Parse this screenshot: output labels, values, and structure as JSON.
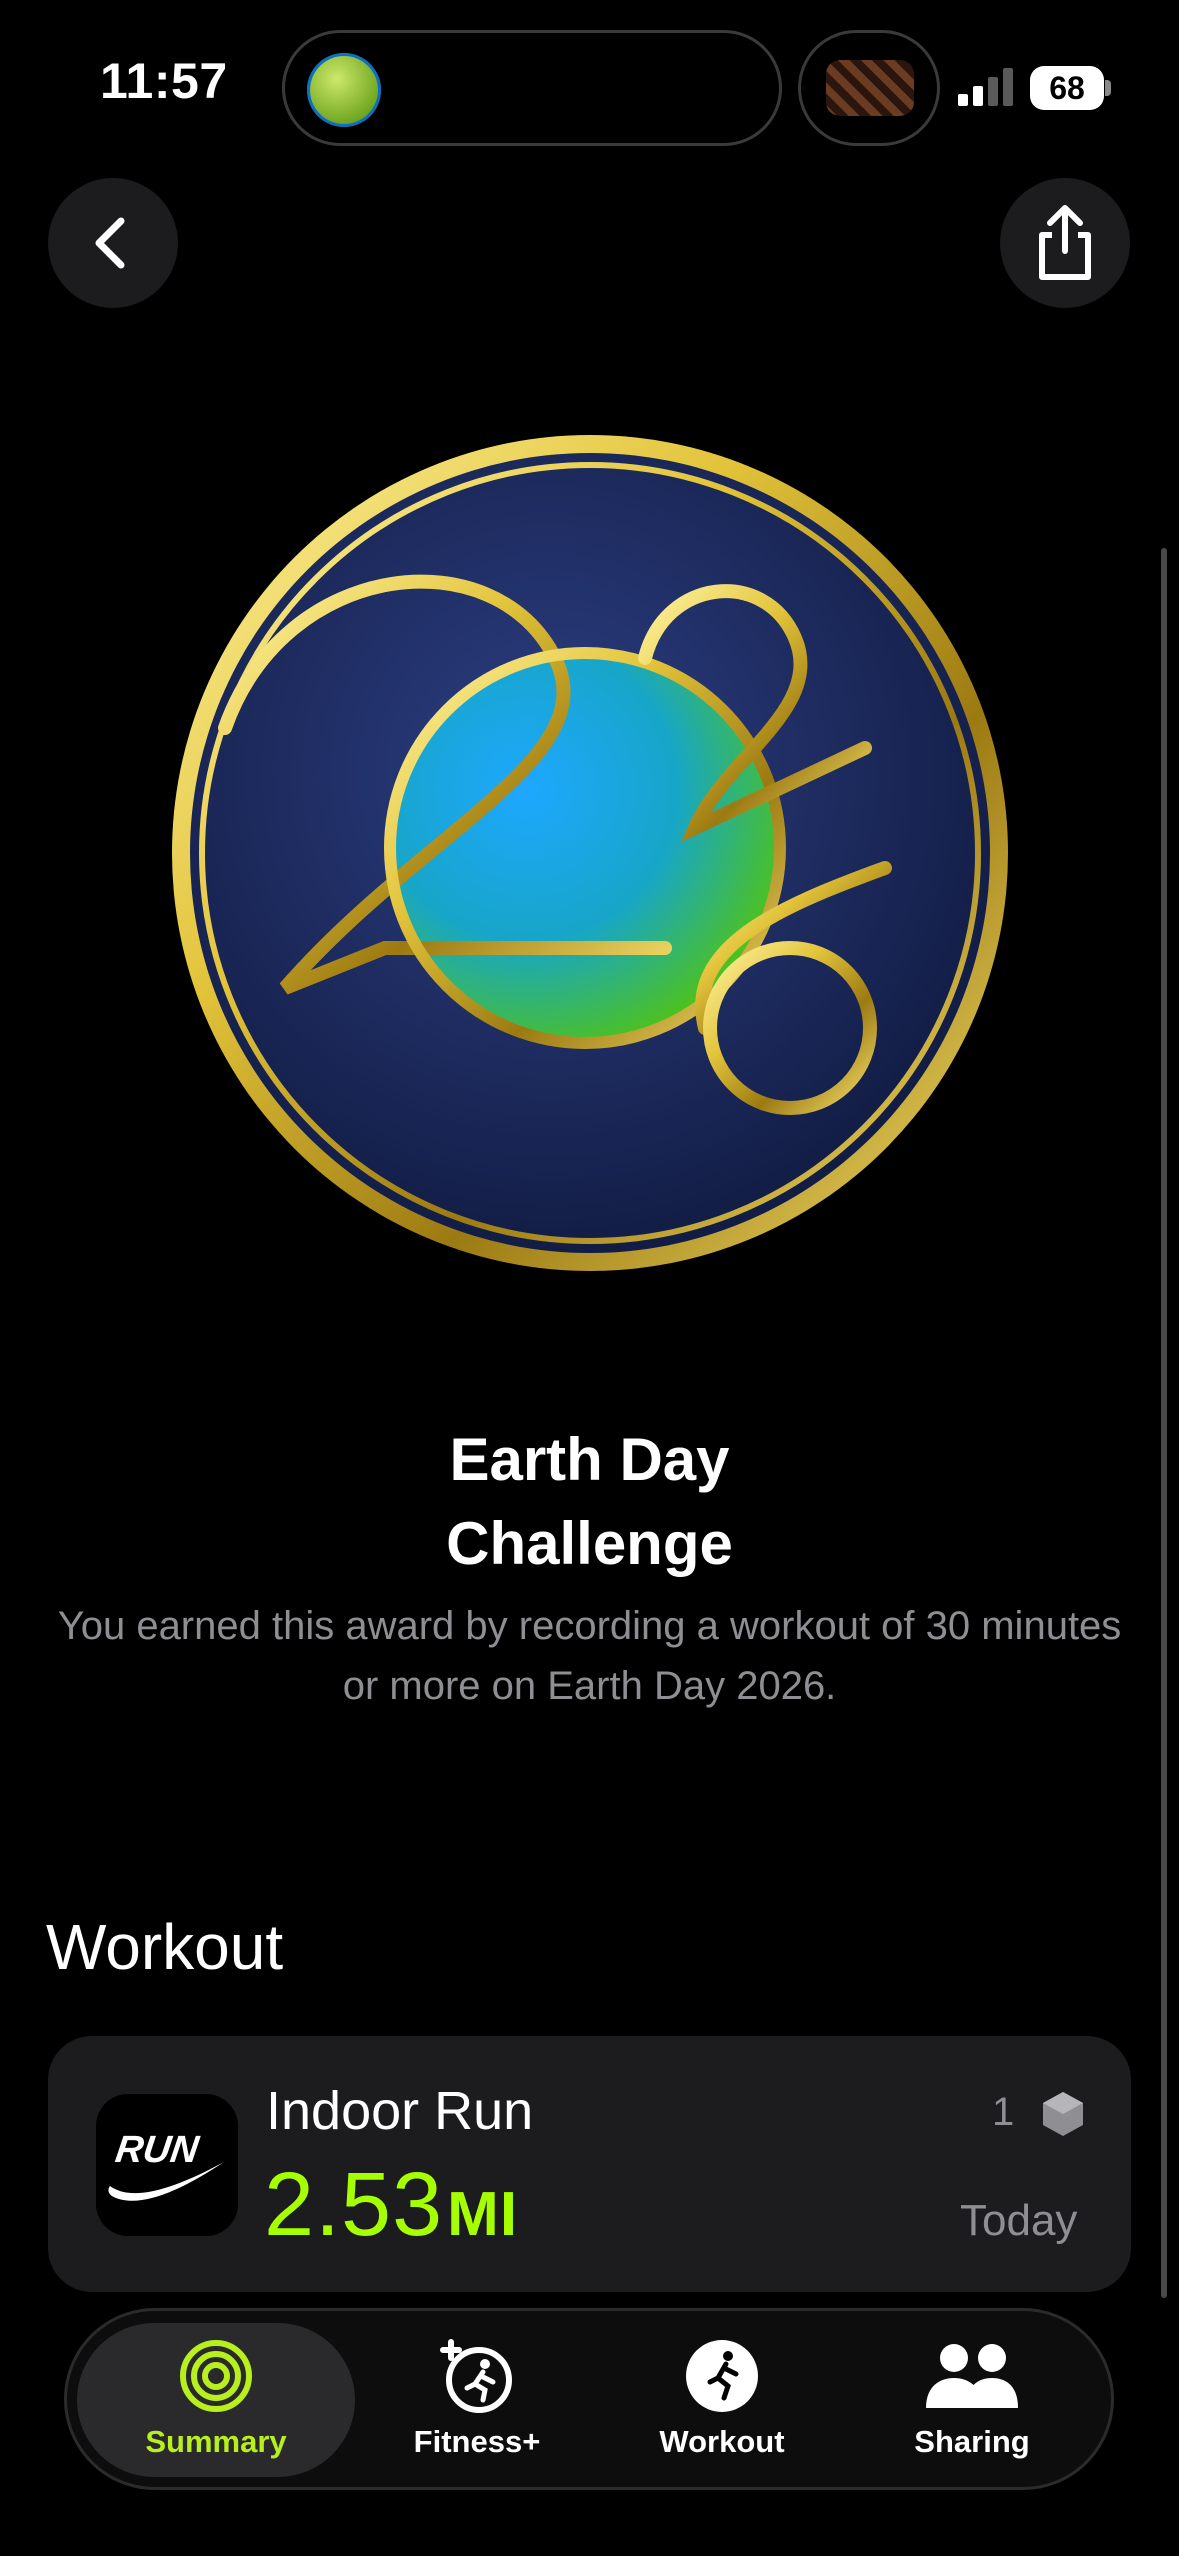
{
  "status_bar": {
    "time": "11:57",
    "battery": "68"
  },
  "nav": {
    "back_icon": "chevron-left-icon",
    "share_icon": "share-icon"
  },
  "award": {
    "medal_year": "2026",
    "title_line1": "Earth Day",
    "title_line2": "Challenge",
    "description": "You earned this award by recording a workout of 30 minutes or more on Earth Day 2026."
  },
  "workout_section": {
    "heading": "Workout",
    "item": {
      "name": "Indoor Run",
      "distance_value": "2.53",
      "distance_unit": "MI",
      "count": "1",
      "date": "Today",
      "icon_text": "RUN",
      "accent": "#a6ff00"
    }
  },
  "tabbar": {
    "tabs": [
      {
        "label": "Summary",
        "icon": "activity-rings-icon",
        "selected": true,
        "color": "#b7f01d"
      },
      {
        "label": "Fitness+",
        "icon": "fitness-plus-icon",
        "selected": false
      },
      {
        "label": "Workout",
        "icon": "running-figure-icon",
        "selected": false
      },
      {
        "label": "Sharing",
        "icon": "people-icon",
        "selected": false
      }
    ]
  }
}
